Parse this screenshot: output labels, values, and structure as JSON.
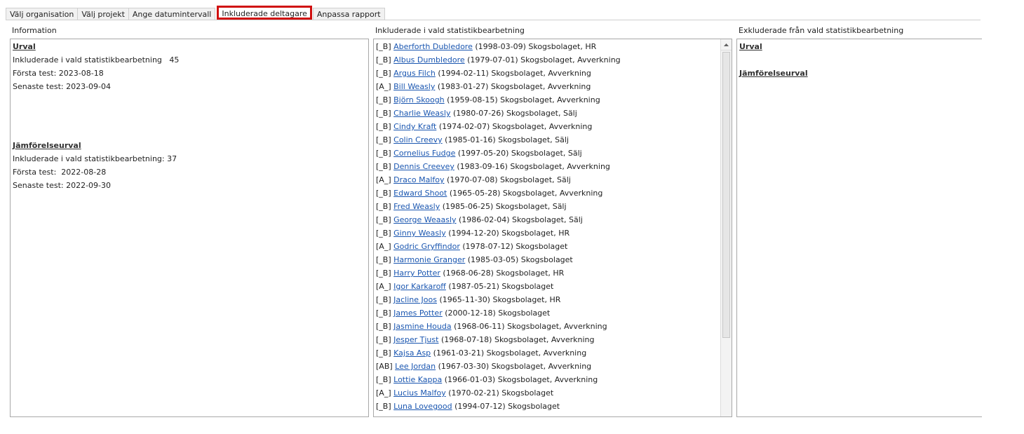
{
  "tabs": [
    {
      "label": "Välj organisation"
    },
    {
      "label": "Välj projekt"
    },
    {
      "label": "Ange datumintervall"
    },
    {
      "label": "Inkluderade deltagare"
    },
    {
      "label": "Anpassa rapport"
    }
  ],
  "active_tab_color": "#d01010",
  "info": {
    "title": "Information",
    "urval_heading": "Urval",
    "urval_included": "Inkluderade i vald statistikbearbetning   45",
    "urval_first": "Första test: 2023-08-18",
    "urval_last": "Senaste test: 2023-09-04",
    "jamf_heading": "Jämförelseurval",
    "jamf_included": "Inkluderade i vald statistikbearbetning: 37",
    "jamf_first": "Första test:  2022-08-28",
    "jamf_last": "Senaste test: 2022-09-30"
  },
  "included": {
    "title": "Inkluderade i vald statistikbearbetning",
    "rows": [
      {
        "code": "[_B]",
        "name": "Aberforth Dubledore",
        "rest": "(1998-03-09) Skogsbolaget, HR"
      },
      {
        "code": "[_B]",
        "name": "Albus Dumbledore",
        "rest": "(1979-07-01) Skogsbolaget, Avverkning"
      },
      {
        "code": "[_B]",
        "name": "Argus Filch",
        "rest": "(1994-02-11) Skogsbolaget, Avverkning"
      },
      {
        "code": "[A_]",
        "name": "Bill Weasly",
        "rest": "(1983-01-27) Skogsbolaget, Avverkning"
      },
      {
        "code": "[_B]",
        "name": "Björn Skoogh",
        "rest": "(1959-08-15) Skogsbolaget, Avverkning"
      },
      {
        "code": "[_B]",
        "name": "Charlie Weasly",
        "rest": "(1980-07-26) Skogsbolaget, Sälj"
      },
      {
        "code": "[_B]",
        "name": "Cindy Kraft",
        "rest": "(1974-02-07) Skogsbolaget, Avverkning"
      },
      {
        "code": "[_B]",
        "name": "Colin Creevy",
        "rest": "(1985-01-16) Skogsbolaget, Sälj"
      },
      {
        "code": "[_B]",
        "name": "Cornelius Fudge",
        "rest": "(1997-05-20) Skogsbolaget, Sälj"
      },
      {
        "code": "[_B]",
        "name": "Dennis Creevey",
        "rest": "(1983-09-16) Skogsbolaget, Avverkning"
      },
      {
        "code": "[A_]",
        "name": "Draco Malfoy",
        "rest": "(1970-07-08) Skogsbolaget, Sälj"
      },
      {
        "code": "[_B]",
        "name": "Edward Shoot",
        "rest": "(1965-05-28) Skogsbolaget, Avverkning"
      },
      {
        "code": "[_B]",
        "name": "Fred Weasly",
        "rest": "(1985-06-25) Skogsbolaget, Sälj"
      },
      {
        "code": "[_B]",
        "name": "George Weaasly",
        "rest": "(1986-02-04) Skogsbolaget, Sälj"
      },
      {
        "code": "[_B]",
        "name": "Ginny Weasly",
        "rest": "(1994-12-20) Skogsbolaget, HR"
      },
      {
        "code": "[A_]",
        "name": "Godric Gryffindor",
        "rest": "(1978-07-12) Skogsbolaget"
      },
      {
        "code": "[_B]",
        "name": "Harmonie Granger",
        "rest": "(1985-03-05) Skogsbolaget"
      },
      {
        "code": "[_B]",
        "name": "Harry Potter",
        "rest": "(1968-06-28) Skogsbolaget, HR"
      },
      {
        "code": "[A_]",
        "name": "Igor Karkaroff",
        "rest": "(1987-05-21) Skogsbolaget"
      },
      {
        "code": "[_B]",
        "name": "Jacline Joos",
        "rest": "(1965-11-30) Skogsbolaget, HR"
      },
      {
        "code": "[_B]",
        "name": "James Potter",
        "rest": "(2000-12-18) Skogsbolaget"
      },
      {
        "code": "[_B]",
        "name": "Jasmine Houda",
        "rest": "(1968-06-11) Skogsbolaget, Avverkning"
      },
      {
        "code": "[_B]",
        "name": "Jesper Tjust",
        "rest": "(1968-07-18) Skogsbolaget, Avverkning"
      },
      {
        "code": "[_B]",
        "name": "Kajsa Asp",
        "rest": "(1961-03-21) Skogsbolaget, Avverkning"
      },
      {
        "code": "[AB]",
        "name": "Lee Jordan",
        "rest": "(1967-03-30) Skogsbolaget, Avverkning"
      },
      {
        "code": "[_B]",
        "name": "Lottie Kappa",
        "rest": "(1966-01-03) Skogsbolaget, Avverkning"
      },
      {
        "code": "[A_]",
        "name": "Lucius Malfoy",
        "rest": "(1970-02-21) Skogsbolaget"
      },
      {
        "code": "[_B]",
        "name": "Luna Lovegood",
        "rest": "(1994-07-12) Skogsbolaget"
      }
    ]
  },
  "excluded": {
    "title": "Exkluderade från vald statistikbearbetning",
    "urval_heading": "Urval",
    "jamf_heading": "Jämförelseurval"
  },
  "icons": {
    "scroll_up": "up-arrow-icon"
  }
}
